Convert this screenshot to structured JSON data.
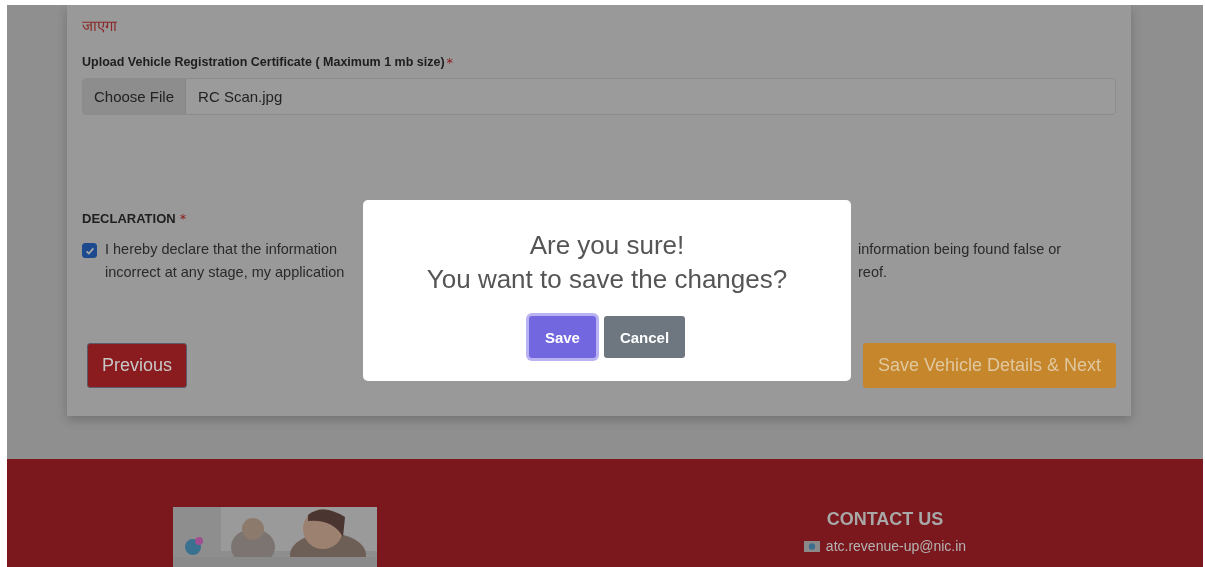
{
  "note": {
    "text": "जाएगा"
  },
  "upload": {
    "label": "Upload Vehicle Registration Certificate ( Maximum 1 mb size)",
    "required_mark": "*",
    "button": "Choose File",
    "value": "RC Scan.jpg"
  },
  "declaration": {
    "heading": "DECLARATION",
    "required_mark": "*",
    "checked": true,
    "left_lines": [
      "I hereby declare that the information",
      "incorrect at any stage, my application"
    ],
    "right_lines": [
      "information being found false or",
      "reof."
    ]
  },
  "buttons": {
    "previous": "Previous",
    "next": "Save Vehicle Details & Next"
  },
  "dialog": {
    "title": "Are you sure!",
    "message": "You want to save the changes?",
    "buttons": [
      {
        "label": "Save",
        "kind": "primary",
        "focused": true
      },
      {
        "label": "Cancel",
        "kind": "secondary",
        "focused": false
      }
    ]
  },
  "footer": {
    "contact": {
      "heading": "CONTACT US",
      "email": "atc.revenue-up@nic.in"
    }
  }
}
